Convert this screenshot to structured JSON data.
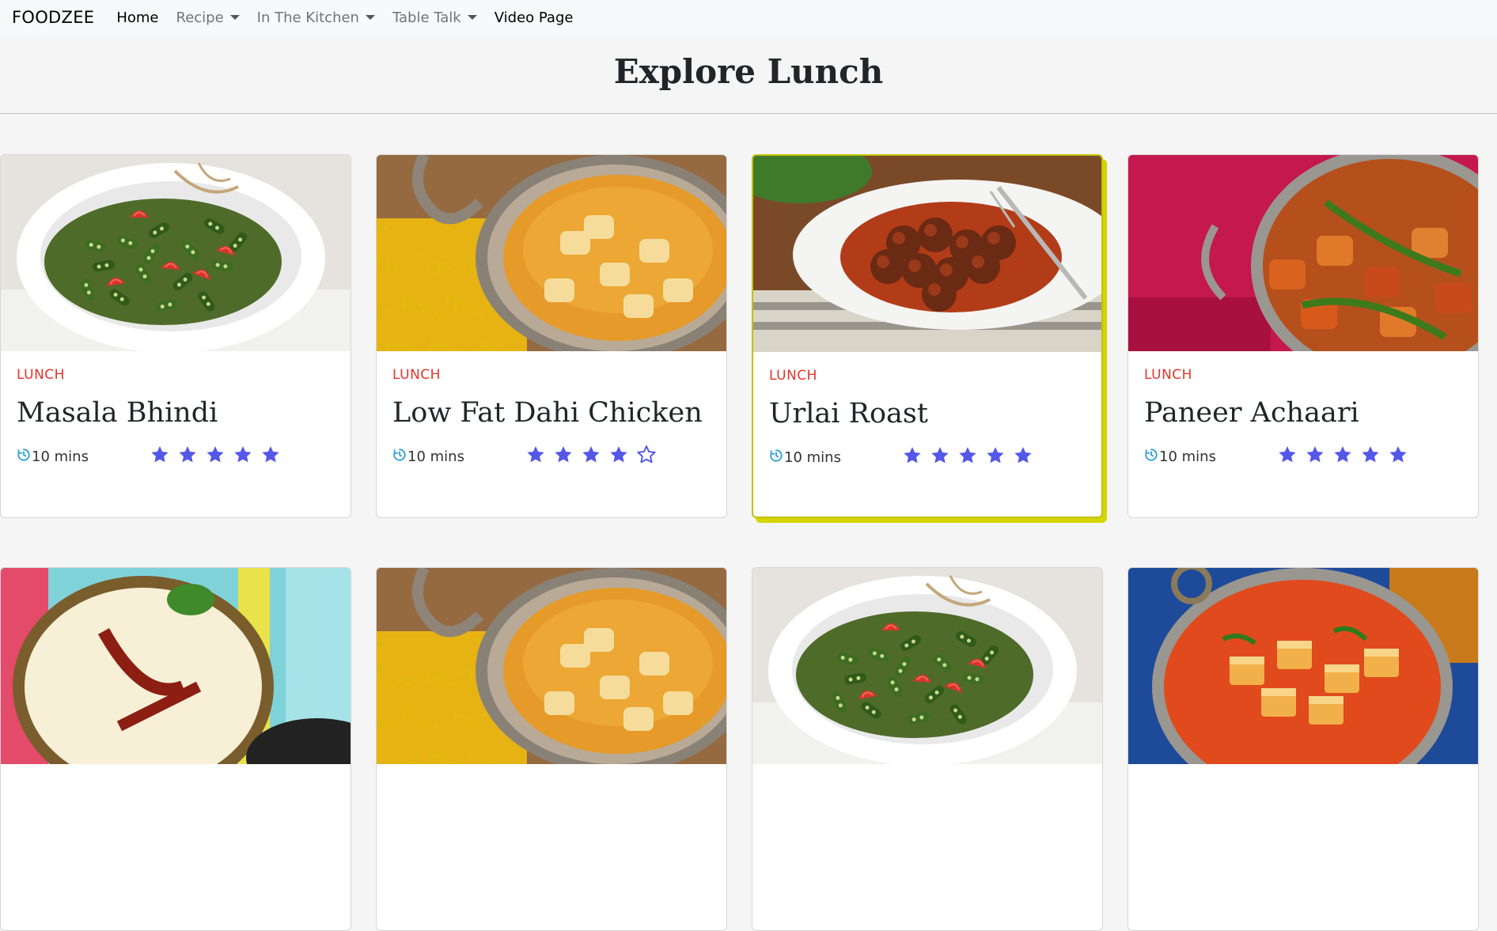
{
  "navbar": {
    "brand": "FOODZEE",
    "items": [
      {
        "label": "Home",
        "dropdown": false,
        "active": true
      },
      {
        "label": "Recipe",
        "dropdown": true,
        "active": false
      },
      {
        "label": "In The Kitchen",
        "dropdown": true,
        "active": false
      },
      {
        "label": "Table Talk",
        "dropdown": true,
        "active": false
      },
      {
        "label": "Video Page",
        "dropdown": false,
        "active": true
      }
    ]
  },
  "header": {
    "title": "Explore Lunch"
  },
  "colors": {
    "accent_category": "#e4342b",
    "star": "#5457e8",
    "clock": "#2a9fd6",
    "highlight_border": "#c2c20a"
  },
  "cards": [
    {
      "category": "LUNCH",
      "title": "Masala Bhindi",
      "time": "10 mins",
      "rating": 5,
      "image": "okra-bowl"
    },
    {
      "category": "LUNCH",
      "title": "Low Fat Dahi Chicken",
      "time": "10 mins",
      "rating": 4,
      "image": "chicken-curry-rice"
    },
    {
      "category": "LUNCH",
      "title": "Urlai Roast",
      "time": "10 mins",
      "rating": 5,
      "image": "roast-plate",
      "highlighted": true
    },
    {
      "category": "LUNCH",
      "title": "Paneer Achaari",
      "time": "10 mins",
      "rating": 5,
      "image": "paneer-curry-pink"
    },
    {
      "image": "kadhi-bowl"
    },
    {
      "image": "chicken-curry-rice"
    },
    {
      "image": "okra-bowl"
    },
    {
      "image": "paneer-butter-masala"
    }
  ]
}
